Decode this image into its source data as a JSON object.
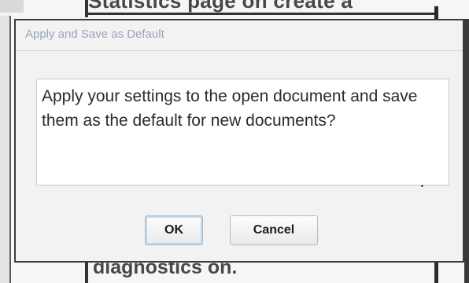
{
  "background": {
    "top_text": "Statistics page on create a",
    "bottom_text": "diagnostics on."
  },
  "dialog": {
    "title": "Apply and Save as Default",
    "message": "Apply your settings to the open document and save them as the default for new documents?",
    "ok_label": "OK",
    "cancel_label": "Cancel"
  },
  "colors": {
    "title_text": "#9aa6b6",
    "dialog_border": "#3c3c3c",
    "default_button_focus": "#bcd8ef"
  }
}
